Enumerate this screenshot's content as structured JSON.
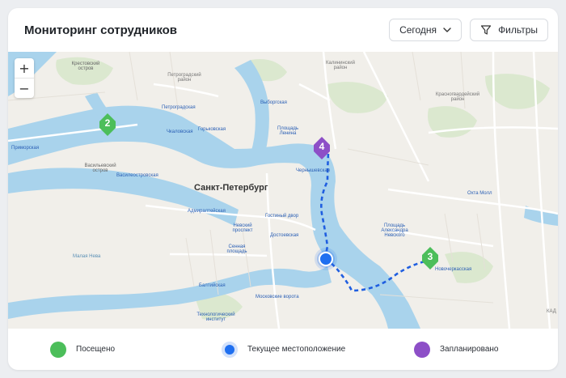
{
  "header": {
    "title": "Мониторинг сотрудников",
    "period_label": "Сегодня",
    "filters_label": "Фильтры"
  },
  "map": {
    "zoom_in": "+",
    "zoom_out": "−",
    "labels": {
      "city": "Санкт-Петербург",
      "krestovsky": "Крестовский остров",
      "petrogradsky": "Петроградский район",
      "kalininsky": "Калининский район",
      "krasnogvardeysky": "Красногвардейский район",
      "vasileostrovsky": "Васильевский остров",
      "primorskaya": "Приморская",
      "vasileostrovskaya": "Василеостровская",
      "petrogradskaya": "Петроградская",
      "gorkovskaya": "Горьковская",
      "chkalovskaya": "Чкаловская",
      "vyborgskaya": "Выборгская",
      "ploshchad_lenina": "Площадь Ленина",
      "chernyshevskaya": "Чернышевская",
      "admiralteyskaya": "Адмиралтейская",
      "nevsky": "Невский проспект",
      "gostiny": "Гостиный двор",
      "dostoevskaya": "Достоевская",
      "sennaya": "Сенная площадь",
      "baltiyskaya": "Балтийская",
      "moskovskie": "Московские ворота",
      "technolog": "Технологический институт",
      "ploshchad_nevskogo": "Площадь Александра Невского",
      "novocherkasskaya": "Новочеркасская",
      "okhta": "Охта Молл",
      "mataly": "Малая Нева",
      "kad": "КАД"
    },
    "markers": [
      {
        "label": "2",
        "status": "visited"
      },
      {
        "label": "4",
        "status": "planned"
      },
      {
        "label": "3",
        "status": "visited"
      }
    ]
  },
  "legend": {
    "visited": "Посещено",
    "current": "Текущее местоположение",
    "planned": "Запланировано"
  },
  "colors": {
    "visited": "#4cbe5a",
    "planned": "#8d4fc7",
    "current": "#1f6ff0",
    "route": "#1f5ee0",
    "water": "#a9d3ec"
  }
}
